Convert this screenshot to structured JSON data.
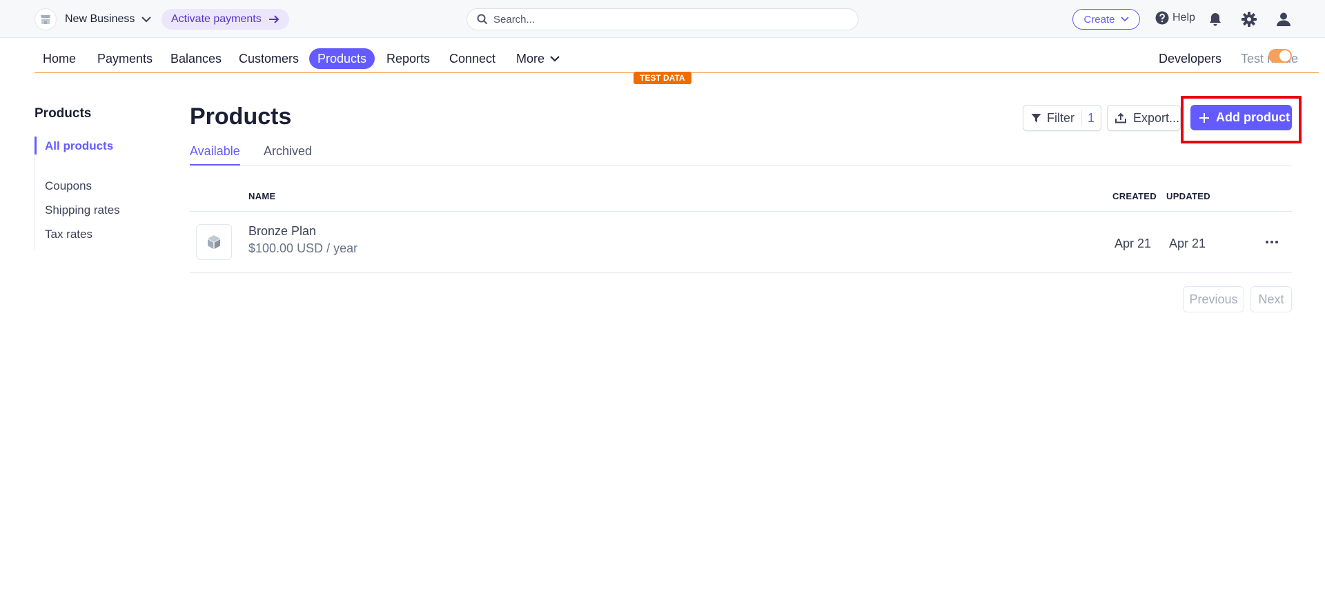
{
  "topbar": {
    "account_name": "New Business",
    "activate_label": "Activate payments",
    "search_placeholder": "Search...",
    "create_label": "Create",
    "help_label": "Help"
  },
  "nav": {
    "items": [
      {
        "label": "Home"
      },
      {
        "label": "Payments"
      },
      {
        "label": "Balances"
      },
      {
        "label": "Customers"
      },
      {
        "label": "Products",
        "active": true
      },
      {
        "label": "Reports"
      },
      {
        "label": "Connect"
      },
      {
        "label": "More"
      }
    ],
    "developers_label": "Developers",
    "test_mode_label": "Test mode",
    "test_mode_on": true,
    "test_data_badge": "TEST DATA"
  },
  "sidebar": {
    "title": "Products",
    "items": [
      {
        "label": "All products",
        "active": true
      },
      {
        "label": "Coupons"
      },
      {
        "label": "Shipping rates"
      },
      {
        "label": "Tax rates"
      }
    ]
  },
  "main": {
    "title": "Products",
    "filter_label": "Filter",
    "filter_count": "1",
    "export_label": "Export...",
    "add_label": "Add product",
    "tabs": [
      {
        "label": "Available",
        "active": true
      },
      {
        "label": "Archived"
      }
    ],
    "columns": {
      "name": "NAME",
      "created": "CREATED",
      "updated": "UPDATED"
    },
    "rows": [
      {
        "name": "Bronze Plan",
        "price": "$100.00 USD / year",
        "created": "Apr 21",
        "updated": "Apr 21"
      }
    ],
    "pagination": {
      "previous": "Previous",
      "next": "Next"
    }
  },
  "colors": {
    "accent": "#635bff",
    "test_orange": "#ef6c00",
    "highlight_red": "#e8000d"
  }
}
